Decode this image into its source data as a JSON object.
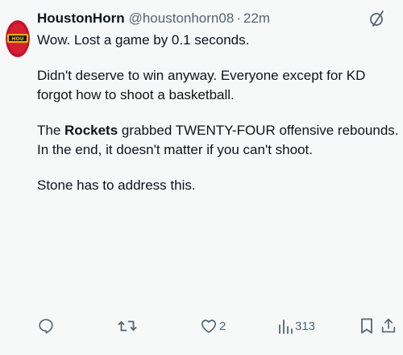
{
  "tweet": {
    "author": {
      "display_name": "HoustonHorn",
      "handle": "@houstonhorn08",
      "separator": "·",
      "time": "22m",
      "avatar_icon": "rockets-logo-avatar"
    },
    "paragraphs": [
      {
        "segments": [
          {
            "text": "Wow. Lost a game by 0.1 seconds."
          }
        ]
      },
      {
        "segments": [
          {
            "text": "Didn't deserve to win anyway. Everyone except for KD forgot how to shoot a basketball."
          }
        ]
      },
      {
        "segments": [
          {
            "text": "The "
          },
          {
            "text": "Rockets",
            "bold": true
          },
          {
            "text": " grabbed TWENTY-FOUR offensive rebounds. In the end, it doesn't matter if you can't shoot."
          }
        ]
      },
      {
        "segments": [
          {
            "text": "Stone has to address this."
          }
        ]
      }
    ],
    "actions": {
      "reply": {
        "icon": "reply-icon",
        "count": ""
      },
      "repost": {
        "icon": "repost-icon",
        "count": ""
      },
      "like": {
        "icon": "heart-icon",
        "count": "2"
      },
      "views": {
        "icon": "views-icon",
        "count": "313"
      },
      "bookmark": {
        "icon": "bookmark-icon",
        "count": ""
      },
      "share": {
        "icon": "share-icon",
        "count": ""
      }
    },
    "colors": {
      "text": "#0f1419",
      "secondary": "#536471",
      "background": "#f7f9f9",
      "avatar_red": "#c8102e",
      "avatar_gold": "#f5b800"
    }
  }
}
